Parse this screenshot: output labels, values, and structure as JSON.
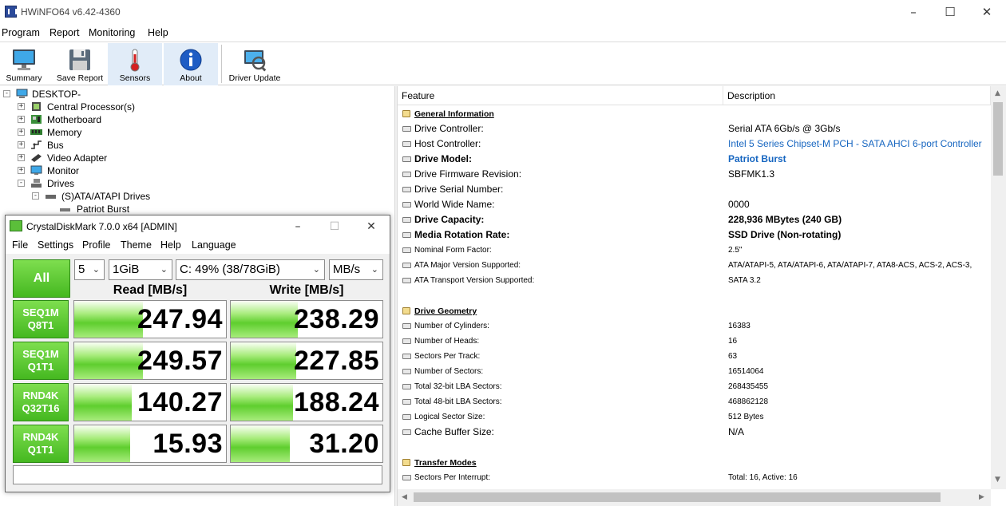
{
  "window": {
    "title": "HWiNFO64 v6.42-4360"
  },
  "menu": [
    "Program",
    "Report",
    "Monitoring",
    "Help"
  ],
  "toolbar": {
    "summary": "Summary",
    "save_report": "Save Report",
    "sensors": "Sensors",
    "about": "About",
    "driver_update": "Driver Update"
  },
  "tree": {
    "root": "DESKTOP-",
    "items": [
      "Central Processor(s)",
      "Motherboard",
      "Memory",
      "Bus",
      "Video Adapter",
      "Monitor",
      "Drives",
      "(S)ATA/ATAPI Drives",
      "Patriot Burst"
    ]
  },
  "details": {
    "headers": {
      "feature": "Feature",
      "description": "Description"
    },
    "rows": [
      {
        "feature": "General Information",
        "description": ""
      },
      {
        "feature": "Drive Controller:",
        "description": "Serial ATA 6Gb/s @ 3Gb/s"
      },
      {
        "feature": "Host Controller:",
        "description": "Intel 5 Series Chipset-M PCH - SATA AHCI 6-port Controller"
      },
      {
        "feature": "Drive Model:",
        "description": "Patriot Burst"
      },
      {
        "feature": "Drive Firmware Revision:",
        "description": "SBFMK1.3"
      },
      {
        "feature": "Drive Serial Number:",
        "description": ""
      },
      {
        "feature": "World Wide Name:",
        "description": "0000"
      },
      {
        "feature": "Drive Capacity:",
        "description": "228,936 MBytes (240 GB)"
      },
      {
        "feature": "Media Rotation Rate:",
        "description": "SSD Drive (Non-rotating)"
      },
      {
        "feature": "Nominal Form Factor:",
        "description": "2.5\""
      },
      {
        "feature": "ATA Major Version Supported:",
        "description": "ATA/ATAPI-5, ATA/ATAPI-6, ATA/ATAPI-7, ATA8-ACS, ACS-2, ACS-3,"
      },
      {
        "feature": "ATA Transport Version Supported:",
        "description": "SATA 3.2"
      },
      {
        "feature": "",
        "description": ""
      },
      {
        "feature": "Drive Geometry",
        "description": ""
      },
      {
        "feature": "Number of Cylinders:",
        "description": "16383"
      },
      {
        "feature": "Number of Heads:",
        "description": "16"
      },
      {
        "feature": "Sectors Per Track:",
        "description": "63"
      },
      {
        "feature": "Number of Sectors:",
        "description": "16514064"
      },
      {
        "feature": "Total 32-bit LBA Sectors:",
        "description": "268435455"
      },
      {
        "feature": "Total 48-bit LBA Sectors:",
        "description": "468862128"
      },
      {
        "feature": "Logical Sector Size:",
        "description": "512 Bytes"
      },
      {
        "feature": "Cache Buffer Size:",
        "description": "N/A"
      },
      {
        "feature": "",
        "description": ""
      },
      {
        "feature": "Transfer Modes",
        "description": ""
      },
      {
        "feature": "Sectors Per Interrupt:",
        "description": "Total: 16, Active: 16"
      }
    ]
  },
  "cdm": {
    "title": "CrystalDiskMark 7.0.0 x64 [ADMIN]",
    "menu": [
      "File",
      "Settings",
      "Profile",
      "Theme",
      "Help",
      "Language"
    ],
    "all_label": "All",
    "count": "5",
    "size": "1GiB",
    "drive": "C: 49% (38/78GiB)",
    "unit": "MB/s",
    "read_header": "Read [MB/s]",
    "write_header": "Write [MB/s]",
    "tests": [
      {
        "line1": "SEQ1M",
        "line2": "Q8T1",
        "read": "247.94",
        "write": "238.29",
        "read_level": 0.45,
        "write_level": 0.44
      },
      {
        "line1": "SEQ1M",
        "line2": "Q1T1",
        "read": "249.57",
        "write": "227.85",
        "read_level": 0.45,
        "write_level": 0.43
      },
      {
        "line1": "RND4K",
        "line2": "Q32T16",
        "read": "140.27",
        "write": "188.24",
        "read_level": 0.38,
        "write_level": 0.41
      },
      {
        "line1": "RND4K",
        "line2": "Q1T1",
        "read": "15.93",
        "write": "31.20",
        "read_level": 0.37,
        "write_level": 0.39
      }
    ]
  }
}
